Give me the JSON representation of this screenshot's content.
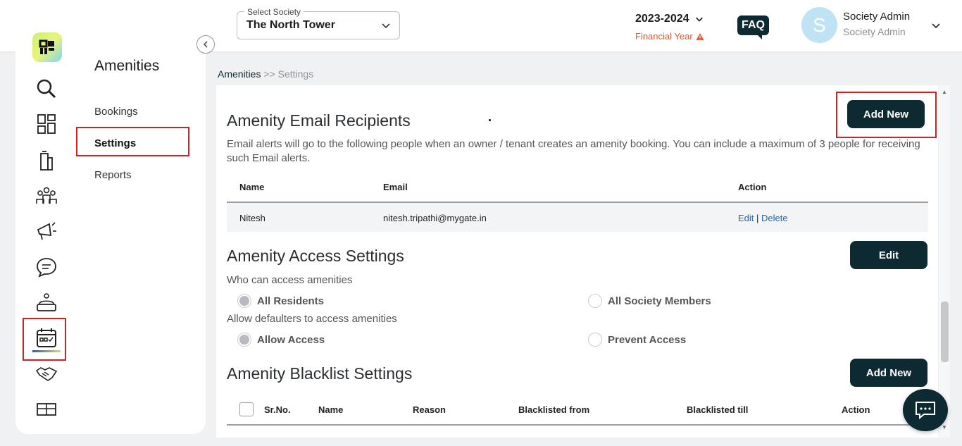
{
  "header": {
    "society_label": "Select Society",
    "society_value": "The North Tower",
    "financial_year": "2023-2024",
    "financial_year_label": "Financial Year",
    "faq_label": "FAQ",
    "avatar_letter": "S",
    "user_name": "Society Admin",
    "user_role": "Society Admin"
  },
  "rail_icons": [
    "search-icon",
    "dashboard-grid-icon",
    "building-icon",
    "residents-group-icon",
    "announcement-icon",
    "chat-bubble-icon",
    "helpdesk-icon",
    "amenities-calendar-icon",
    "handshake-icon",
    "box-icon"
  ],
  "submenu": {
    "title": "Amenities",
    "items": [
      "Bookings",
      "Settings",
      "Reports"
    ],
    "active": "Settings"
  },
  "breadcrumb": {
    "parent": "Amenities",
    "separator": ">>",
    "current": "Settings"
  },
  "email_recipients": {
    "title": "Amenity Email Recipients",
    "add_label": "Add New",
    "description": "Email alerts will go to the following people when an owner / tenant creates an amenity booking. You can include a maximum of 3 people for receiving such Email alerts.",
    "columns": [
      "Name",
      "Email",
      "Action"
    ],
    "rows": [
      {
        "name": "Nitesh",
        "email": "nitesh.tripathi@mygate.in",
        "edit": "Edit",
        "sep": "|",
        "delete": "Delete"
      }
    ]
  },
  "access_settings": {
    "title": "Amenity Access Settings",
    "edit_label": "Edit",
    "q1": "Who can access amenities",
    "q1_options": [
      "All Residents",
      "All Society Members"
    ],
    "q1_selected": "All Residents",
    "q2": "Allow defaulters to access amenities",
    "q2_options": [
      "Allow Access",
      "Prevent Access"
    ],
    "q2_selected": "Allow Access"
  },
  "blacklist": {
    "title": "Amenity Blacklist Settings",
    "add_label": "Add New",
    "columns": [
      "Sr.No.",
      "Name",
      "Reason",
      "Blacklisted from",
      "Blacklisted till",
      "Action"
    ]
  },
  "colors": {
    "primary": "#0d2a33",
    "highlight": "#d81e1e",
    "warning": "#e3562f",
    "link": "#1b66b3"
  }
}
